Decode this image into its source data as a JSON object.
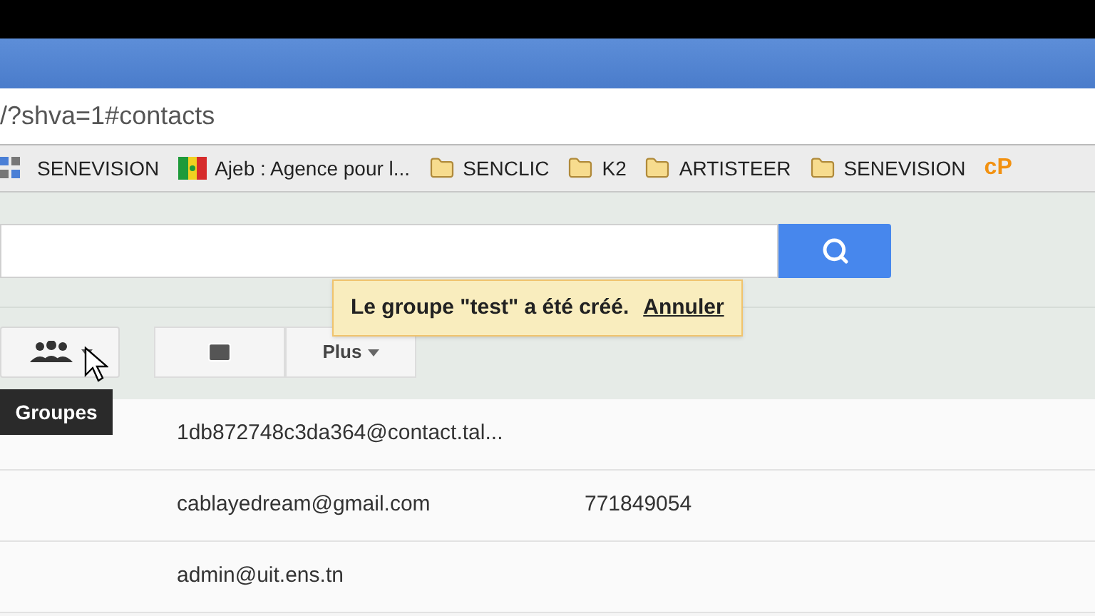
{
  "address_bar": {
    "url": "/?shva=1#contacts"
  },
  "bookmarks": [
    {
      "kind": "apps",
      "label": "SENEVISION"
    },
    {
      "kind": "flag",
      "label": "Ajeb : Agence pour l..."
    },
    {
      "kind": "folder",
      "label": "SENCLIC"
    },
    {
      "kind": "folder",
      "label": "K2"
    },
    {
      "kind": "folder",
      "label": "ARTISTEER"
    },
    {
      "kind": "folder",
      "label": "SENEVISION"
    },
    {
      "kind": "logo",
      "label": "cP"
    }
  ],
  "toast": {
    "message": "Le groupe \"test\" a été créé.",
    "action": "Annuler"
  },
  "toolbar": {
    "more": "Plus",
    "tooltip": "Groupes"
  },
  "contacts": [
    {
      "email": "1db872748c3da364@contact.tal..."
    },
    {
      "email": "cablayedream@gmail.com",
      "phone": "771849054"
    },
    {
      "email": "admin@uit.ens.tn"
    }
  ]
}
